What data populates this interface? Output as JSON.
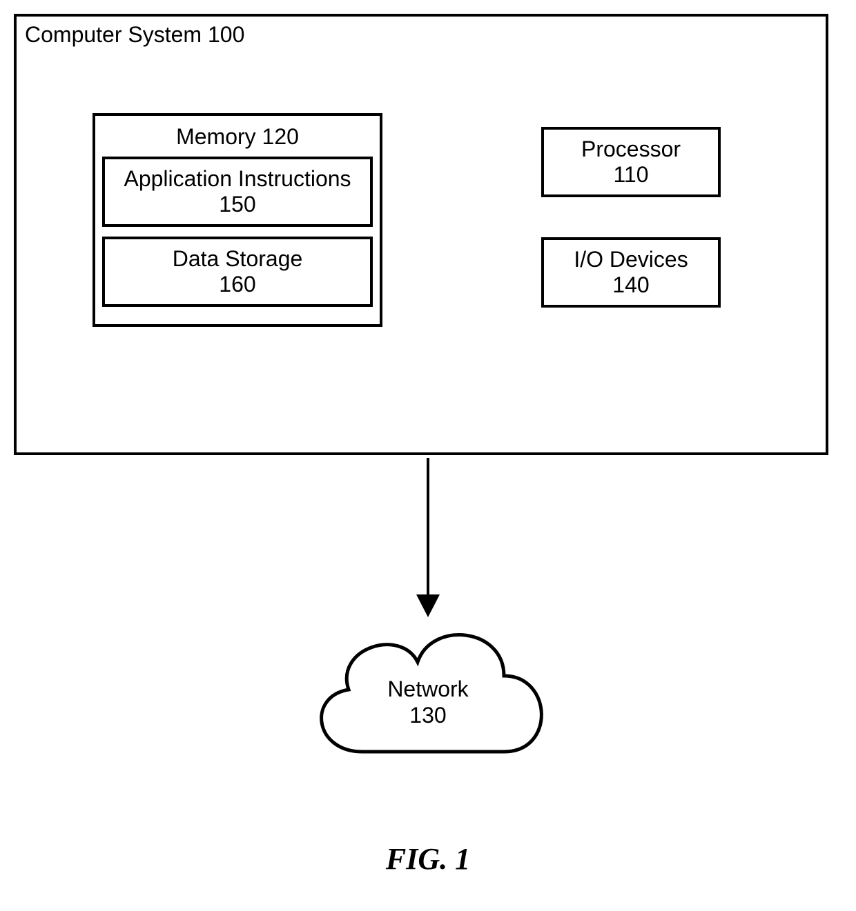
{
  "system": {
    "title": "Computer System 100"
  },
  "memory": {
    "title": "Memory 120",
    "app_instructions": {
      "label": "Application Instructions",
      "num": "150"
    },
    "data_storage": {
      "label": "Data Storage",
      "num": "160"
    }
  },
  "processor": {
    "label": "Processor",
    "num": "110"
  },
  "io_devices": {
    "label": "I/O Devices",
    "num": "140"
  },
  "network": {
    "label": "Network",
    "num": "130"
  },
  "figure_caption": "FIG. 1"
}
